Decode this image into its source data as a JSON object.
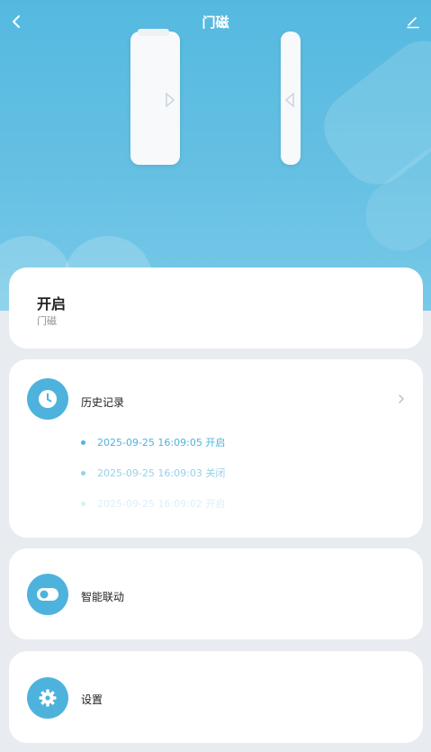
{
  "header": {
    "title": "门磁"
  },
  "status": {
    "value": "开启",
    "subtitle": "门磁"
  },
  "history": {
    "label": "历史记录",
    "records": [
      "2025-09-25 16:09:05 开启",
      "2025-09-25 16:09:03 关闭",
      "2025-09-25 16:09:02 开启"
    ]
  },
  "linkage": {
    "label": "智能联动"
  },
  "settings": {
    "label": "设置"
  },
  "colors": {
    "accent": "#4eb3dc",
    "hero": "#5fbde2",
    "background": "#e8ecf1"
  },
  "icons": {
    "back": "chevron-left-icon",
    "edit": "pencil-icon",
    "history": "clock-icon",
    "linkage": "toggle-icon",
    "settings": "gear-icon",
    "chevron": "chevron-right-icon"
  }
}
